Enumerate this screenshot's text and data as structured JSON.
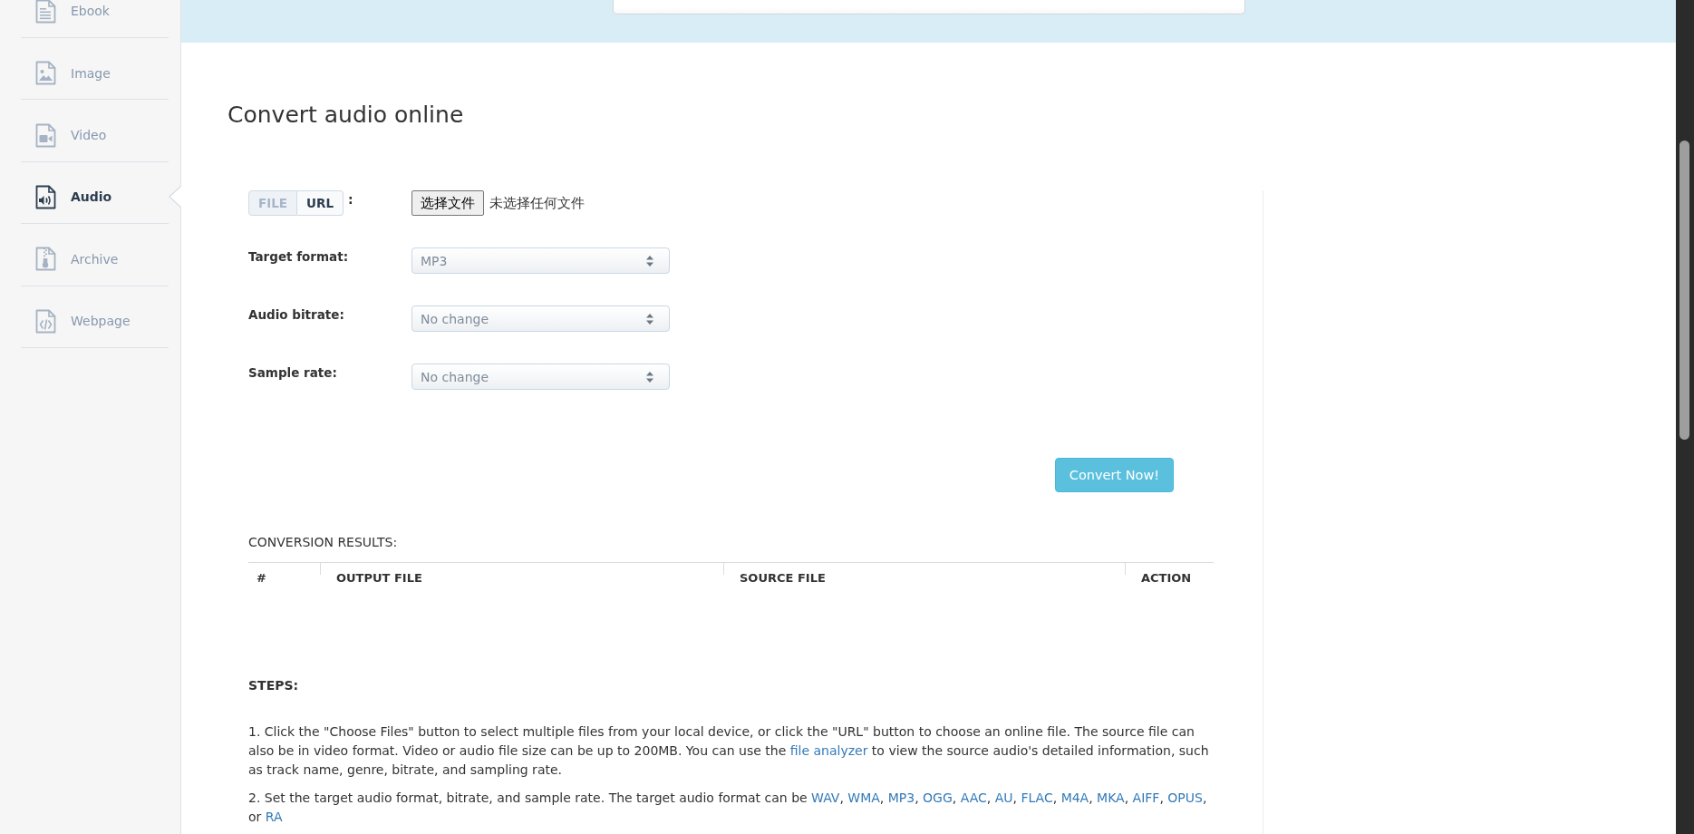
{
  "sidebar": {
    "items": [
      {
        "label": "Ebook",
        "selected": false
      },
      {
        "label": "Image",
        "selected": false
      },
      {
        "label": "Video",
        "selected": false
      },
      {
        "label": "Audio",
        "selected": true
      },
      {
        "label": "Archive",
        "selected": false
      },
      {
        "label": "Webpage",
        "selected": false
      }
    ]
  },
  "page_title": "Convert audio online",
  "source": {
    "modes": [
      {
        "label": "FILE",
        "selected": true
      },
      {
        "label": "URL",
        "selected": false
      }
    ],
    "separator": ":",
    "file_button": "选择文件",
    "file_status": "未选择任何文件"
  },
  "options": [
    {
      "label": "Target format:",
      "value": "MP3"
    },
    {
      "label": "Audio bitrate:",
      "value": "No change"
    },
    {
      "label": "Sample rate:",
      "value": "No change"
    }
  ],
  "convert_button": "Convert Now!",
  "results": {
    "title": "CONVERSION RESULTS:",
    "columns": [
      "#",
      "OUTPUT FILE",
      "SOURCE FILE",
      "ACTION"
    ]
  },
  "steps": {
    "title": "STEPS:",
    "paragraphs": [
      {
        "parts": [
          {
            "kind": "text",
            "text": "1. Click the \"Choose Files\" button to select multiple files from your local device, or click the \"URL\" button to choose an online file. The source file can also be in video format. Video or audio file size can be up to 200MB. You can use the "
          },
          {
            "kind": "link",
            "text": "file analyzer"
          },
          {
            "kind": "text",
            "text": " to view the source audio's detailed information, such as track name, genre, bitrate, and sampling rate."
          }
        ]
      },
      {
        "parts": [
          {
            "kind": "text",
            "text": "2. Set the target audio format, bitrate, and sample rate. The target audio format can be "
          },
          {
            "kind": "link",
            "text": "WAV"
          },
          {
            "kind": "text",
            "text": ", "
          },
          {
            "kind": "link",
            "text": "WMA"
          },
          {
            "kind": "text",
            "text": ", "
          },
          {
            "kind": "link",
            "text": "MP3"
          },
          {
            "kind": "text",
            "text": ", "
          },
          {
            "kind": "link",
            "text": "OGG"
          },
          {
            "kind": "text",
            "text": ", "
          },
          {
            "kind": "link",
            "text": "AAC"
          },
          {
            "kind": "text",
            "text": ", "
          },
          {
            "kind": "link",
            "text": "AU"
          },
          {
            "kind": "text",
            "text": ", "
          },
          {
            "kind": "link",
            "text": "FLAC"
          },
          {
            "kind": "text",
            "text": ", "
          },
          {
            "kind": "link",
            "text": "M4A"
          },
          {
            "kind": "text",
            "text": ", "
          },
          {
            "kind": "link",
            "text": "MKA"
          },
          {
            "kind": "text",
            "text": ", "
          },
          {
            "kind": "link",
            "text": "AIFF"
          },
          {
            "kind": "text",
            "text": ", "
          },
          {
            "kind": "link",
            "text": "OPUS"
          },
          {
            "kind": "text",
            "text": ", or "
          },
          {
            "kind": "link",
            "text": "RA"
          }
        ]
      }
    ]
  }
}
